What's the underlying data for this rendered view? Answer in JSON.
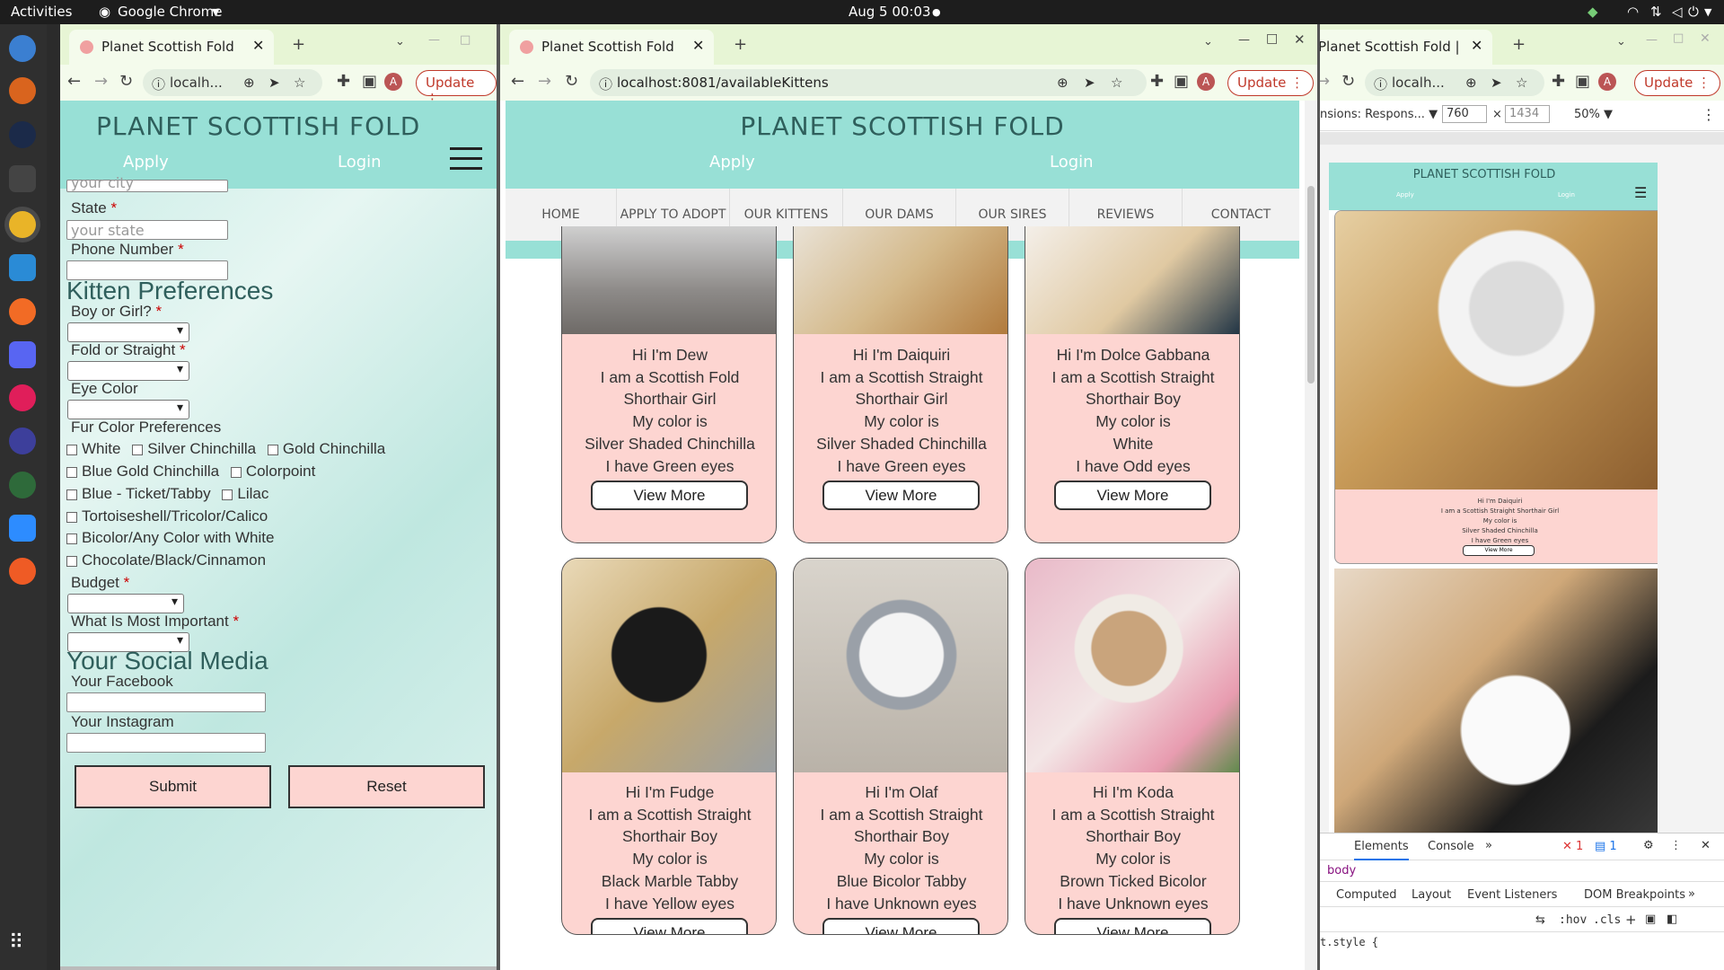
{
  "topbar": {
    "activities": "Activities",
    "app": "Google Chrome",
    "clock": "Aug 5  00:03"
  },
  "dock": {
    "icons": [
      "thunderbird-icon",
      "settings-icon",
      "steam-icon",
      "terminal-icon",
      "chrome-icon",
      "vscode-icon",
      "firefox-icon",
      "discord-icon",
      "slack-icon",
      "eclipse-icon",
      "hubspot-icon",
      "zoom-icon",
      "postman-icon",
      "app-grid-icon"
    ]
  },
  "tab_title": "Planet Scottish Fold | Scot",
  "update_label": "Update",
  "site": {
    "brand": "PLANET SCOTTISH FOLD",
    "apply": "Apply",
    "login": "Login"
  },
  "left": {
    "url": "localh...",
    "city_placeholder": "your city",
    "state_label": "State",
    "state_placeholder": "your state",
    "phone_label": "Phone Number",
    "kitten_heading": "Kitten Preferences",
    "boy_label": "Boy or Girl?",
    "fold_label": "Fold or Straight",
    "eye_label": "Eye Color",
    "fur_label": "Fur Color Preferences",
    "fur_options": [
      "White",
      "Silver Chinchilla",
      "Gold Chinchilla",
      "Blue Gold Chinchilla",
      "Colorpoint",
      "Blue - Ticket/Tabby",
      "Lilac",
      "Tortoiseshell/Tricolor/Calico",
      "Bicolor/Any Color with White",
      "Chocolate/Black/Cinnamon"
    ],
    "budget_label": "Budget",
    "important_label": "What Is Most Important",
    "social_heading": "Your Social Media",
    "facebook_label": "Your Facebook",
    "instagram_label": "Your Instagram",
    "submit": "Submit",
    "reset": "Reset",
    "required": "*"
  },
  "middle": {
    "url": "localhost:8081/availableKittens",
    "nav": [
      "HOME",
      "APPLY TO ADOPT",
      "OUR KITTENS",
      "OUR DAMS",
      "OUR SIRES",
      "REVIEWS",
      "CONTACT"
    ],
    "view_more": "View More",
    "kittens": [
      {
        "name": "Hi I'm Dew",
        "breed": "I am a Scottish Fold",
        "type": "Shorthair Girl",
        "color_intro": "My color is",
        "color": "Silver Shaded Chinchilla",
        "eyes": "I have Green eyes"
      },
      {
        "name": "Hi I'm Daiquiri",
        "breed": "I am a Scottish Straight",
        "type": "Shorthair Girl",
        "color_intro": "My color is",
        "color": "Silver Shaded Chinchilla",
        "eyes": "I have Green eyes"
      },
      {
        "name": "Hi I'm Dolce Gabbana",
        "breed": "I am a Scottish Straight",
        "type": "Shorthair Boy",
        "color_intro": "My color is",
        "color": "White",
        "eyes": "I have Odd eyes"
      },
      {
        "name": "Hi I'm Fudge",
        "breed": "I am a Scottish Straight",
        "type": "Shorthair Boy",
        "color_intro": "My color is",
        "color": "Black Marble Tabby",
        "eyes": "I have Yellow eyes"
      },
      {
        "name": "Hi I'm Olaf",
        "breed": "I am a Scottish Straight",
        "type": "Shorthair Boy",
        "color_intro": "My color is",
        "color": "Blue Bicolor Tabby",
        "eyes": "I have Unknown eyes"
      },
      {
        "name": "Hi I'm Koda",
        "breed": "I am a Scottish Straight",
        "type": "Shorthair Boy",
        "color_intro": "My color is",
        "color": "Brown Ticked Bicolor",
        "eyes": "I have Unknown eyes"
      }
    ]
  },
  "right": {
    "url": "localh...",
    "dimensions_label": "nsions: Respons...",
    "width": "760",
    "times": "×",
    "height": "1434",
    "zoom": "50%",
    "mini_lines": [
      "Hi I'm Daiquiri",
      "I am a Scottish Straight Shorthair Girl",
      "My color is",
      "Silver Shaded Chinchilla",
      "I have Green eyes"
    ],
    "devtools": {
      "tabs": [
        "Elements",
        "Console"
      ],
      "errors": "1",
      "messages": "1",
      "crumb": "body",
      "subtabs": [
        "Computed",
        "Layout",
        "Event Listeners",
        "DOM Breakpoints"
      ],
      "hov": ":hov",
      ".cls": ".cls",
      "style": "t.style {"
    }
  }
}
